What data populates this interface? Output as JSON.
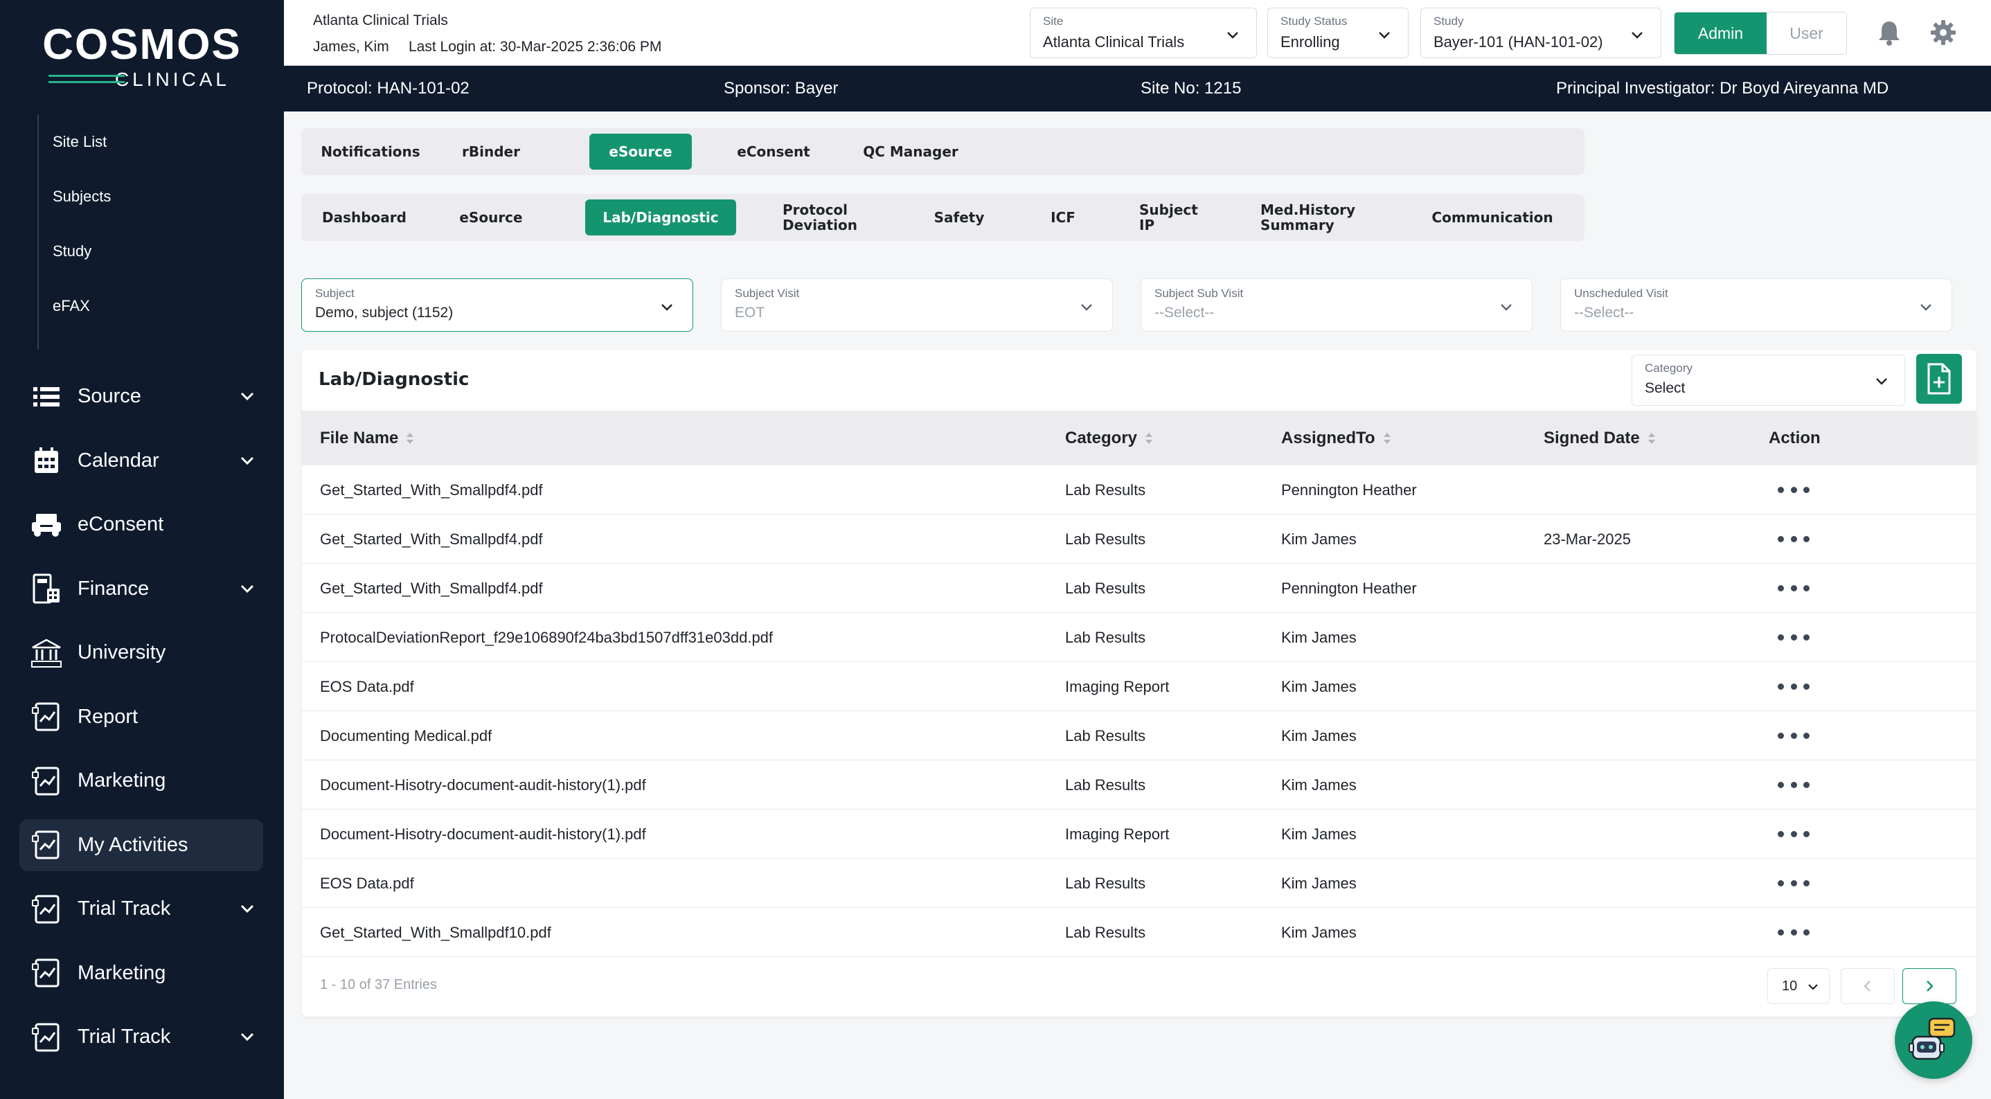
{
  "sidebar": {
    "logo": {
      "top": "COSMOS",
      "bottom": "CLINICAL"
    },
    "sub_links": [
      "Site List",
      "Subjects",
      "Study",
      "eFAX"
    ],
    "menu": [
      {
        "label": "Source",
        "icon": "list-icon",
        "expandable": true
      },
      {
        "label": "Calendar",
        "icon": "calendar-icon",
        "expandable": true
      },
      {
        "label": "eConsent",
        "icon": "consent-icon",
        "expandable": false
      },
      {
        "label": "Finance",
        "icon": "finance-icon",
        "expandable": true
      },
      {
        "label": "University",
        "icon": "university-icon",
        "expandable": false
      },
      {
        "label": "Report",
        "icon": "report-icon",
        "expandable": false
      },
      {
        "label": "Marketing",
        "icon": "report-icon",
        "expandable": false
      },
      {
        "label": "My Activities",
        "icon": "report-icon",
        "expandable": false,
        "active": true
      },
      {
        "label": "Trial Track",
        "icon": "report-icon",
        "expandable": true
      },
      {
        "label": "Marketing",
        "icon": "report-icon",
        "expandable": false
      },
      {
        "label": "Trial Track",
        "icon": "report-icon",
        "expandable": true
      }
    ]
  },
  "header": {
    "site_name": "Atlanta Clinical Trials",
    "user_name": "James, Kim",
    "last_login": "Last Login at: 30-Mar-2025 2:36:06 PM",
    "site_select": {
      "label": "Site",
      "value": "Atlanta Clinical Trials"
    },
    "status_select": {
      "label": "Study Status",
      "value": "Enrolling"
    },
    "study_select": {
      "label": "Study",
      "value": "Bayer-101 (HAN-101-02)"
    },
    "role_admin": "Admin",
    "role_user": "User"
  },
  "protocol_bar": {
    "protocol": "Protocol: HAN-101-02",
    "sponsor": "Sponsor: Bayer",
    "site_no": "Site No: 1215",
    "pi": "Principal Investigator: Dr Boyd Aireyanna MD"
  },
  "top_tabs": [
    "Notifications",
    "rBinder",
    "eSource",
    "eConsent",
    "QC Manager"
  ],
  "sub_tabs": [
    "Dashboard",
    "eSource",
    "Lab/Diagnostic",
    "Protocol Deviation",
    "Safety",
    "ICF",
    "Subject IP",
    "Med.History Summary",
    "Communication"
  ],
  "filters": {
    "subject": {
      "label": "Subject",
      "value": "Demo, subject (1152)"
    },
    "visit": {
      "label": "Subject Visit",
      "value": "EOT"
    },
    "sub_visit": {
      "label": "Subject Sub Visit",
      "value": "--Select--"
    },
    "unscheduled": {
      "label": "Unscheduled Visit",
      "value": "--Select--"
    }
  },
  "card": {
    "title": "Lab/Diagnostic",
    "category_select": {
      "label": "Category",
      "value": "Select"
    }
  },
  "table": {
    "columns": [
      "File Name",
      "Category",
      "AssignedTo",
      "Signed Date",
      "Action"
    ],
    "rows": [
      {
        "file": "Get_Started_With_Smallpdf4.pdf",
        "category": "Lab Results",
        "assigned": "Pennington Heather",
        "signed": ""
      },
      {
        "file": "Get_Started_With_Smallpdf4.pdf",
        "category": "Lab Results",
        "assigned": "Kim James",
        "signed": "23-Mar-2025"
      },
      {
        "file": "Get_Started_With_Smallpdf4.pdf",
        "category": "Lab Results",
        "assigned": "Pennington Heather",
        "signed": ""
      },
      {
        "file": "ProtocalDeviationReport_f29e106890f24ba3bd1507dff31e03dd.pdf",
        "category": "Lab Results",
        "assigned": "Kim James",
        "signed": ""
      },
      {
        "file": "EOS Data.pdf",
        "category": "Imaging Report",
        "assigned": "Kim James",
        "signed": ""
      },
      {
        "file": "Documenting Medical.pdf",
        "category": "Lab Results",
        "assigned": "Kim James",
        "signed": ""
      },
      {
        "file": "Document-Hisotry-document-audit-history(1).pdf",
        "category": "Lab Results",
        "assigned": "Kim James",
        "signed": ""
      },
      {
        "file": "Document-Hisotry-document-audit-history(1).pdf",
        "category": "Imaging Report",
        "assigned": "Kim James",
        "signed": ""
      },
      {
        "file": "EOS Data.pdf",
        "category": "Lab Results",
        "assigned": "Kim James",
        "signed": ""
      },
      {
        "file": "Get_Started_With_Smallpdf10.pdf",
        "category": "Lab Results",
        "assigned": "Kim James",
        "signed": ""
      }
    ]
  },
  "pagination": {
    "info": "1 - 10 of 37 Entries",
    "page_size": "10"
  },
  "colors": {
    "accent": "#14956f",
    "sidebar": "#0f1b2d",
    "active_menu": "#1f2b3f"
  }
}
